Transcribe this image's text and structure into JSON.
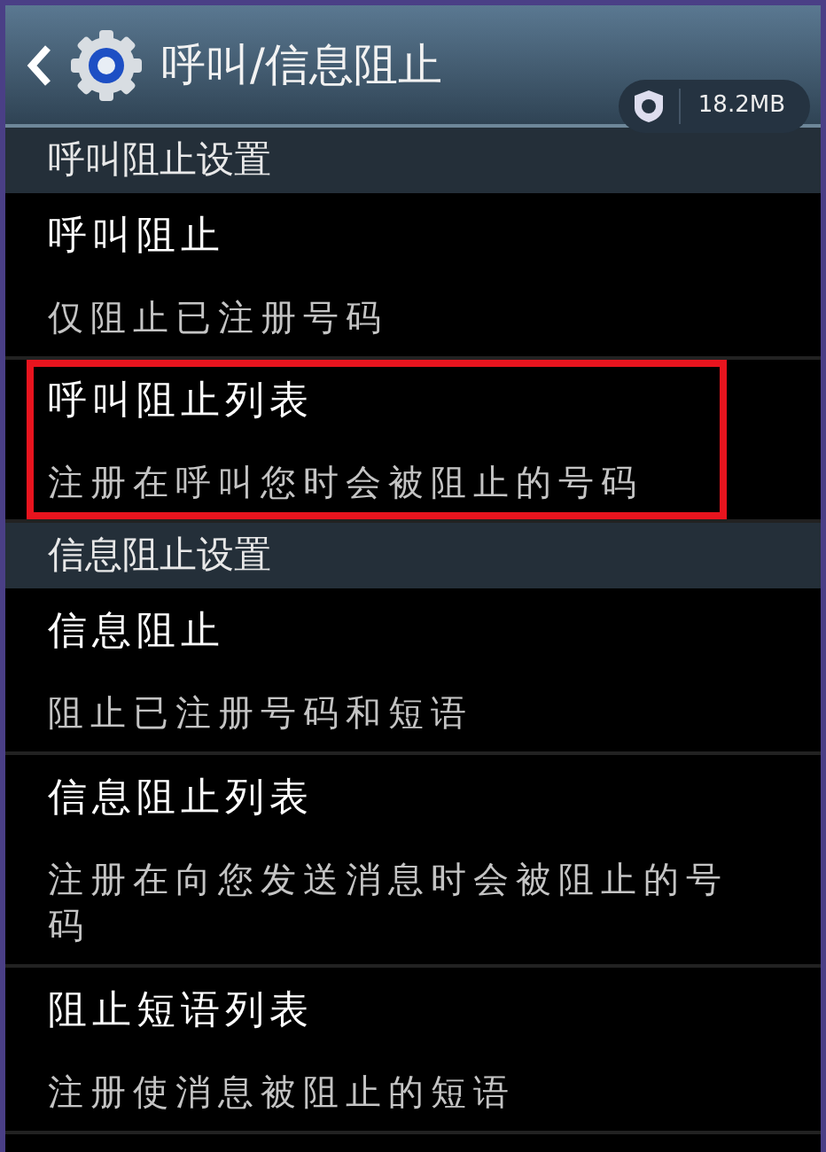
{
  "header": {
    "title": "呼叫/信息阻止",
    "memory_badge": "18.2MB"
  },
  "sections": [
    {
      "title": "呼叫阻止设置",
      "items": [
        {
          "title": "呼叫阻止",
          "summary": "仅阻止已注册号码",
          "highlighted": false
        },
        {
          "title": "呼叫阻止列表",
          "summary": "注册在呼叫您时会被阻止的号码",
          "highlighted": true
        }
      ]
    },
    {
      "title": "信息阻止设置",
      "items": [
        {
          "title": "信息阻止",
          "summary": "阻止已注册号码和短语",
          "highlighted": false
        },
        {
          "title": "信息阻止列表",
          "summary": "注册在向您发送消息时会被阻止的号码",
          "highlighted": false
        },
        {
          "title": "阻止短语列表",
          "summary": "注册使消息被阻止的短语",
          "highlighted": false
        }
      ]
    }
  ]
}
